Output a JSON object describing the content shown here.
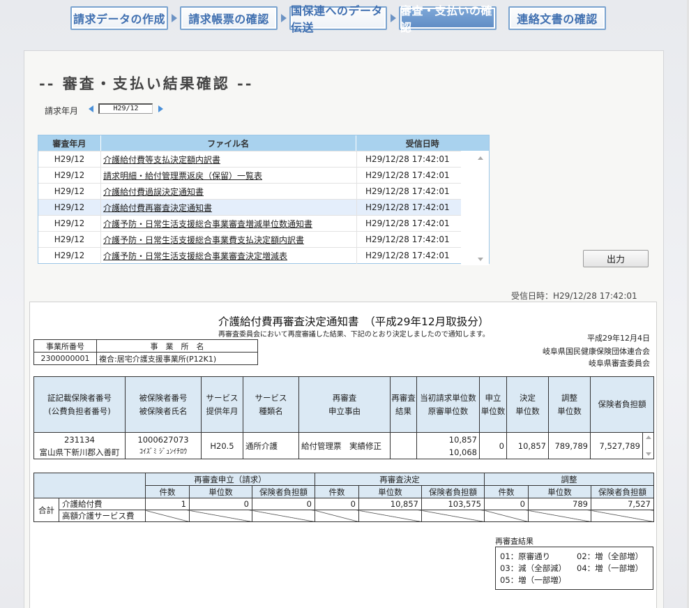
{
  "nav": {
    "items": [
      {
        "label": "請求データの作成",
        "active": false
      },
      {
        "label": "請求帳票の確認",
        "active": false
      },
      {
        "label": "国保連へのデータ伝送",
        "active": false
      },
      {
        "label": "審査・支払いの確認",
        "active": true
      },
      {
        "label": "連絡文書の確認",
        "active": false
      }
    ]
  },
  "page": {
    "title": "-- 審査・支払い結果確認 --",
    "year_month_label": "請求年月",
    "year_month_value": "H29/12"
  },
  "file_table": {
    "headers": [
      "審査年月",
      "ファイル名",
      "受信日時"
    ],
    "rows": [
      {
        "ym": "H29/12",
        "name": "介護給付費等支払決定額内訳書",
        "received": "H29/12/28 17:42:01"
      },
      {
        "ym": "H29/12",
        "name": "請求明細・給付管理票返戻（保留）一覧表",
        "received": "H29/12/28 17:42:01"
      },
      {
        "ym": "H29/12",
        "name": "介護給付費過誤決定通知書",
        "received": "H29/12/28 17:42:01"
      },
      {
        "ym": "H29/12",
        "name": "介護給付費再審査決定通知書",
        "received": "H29/12/28 17:42:01",
        "selected": true
      },
      {
        "ym": "H29/12",
        "name": "介護予防・日常生活支援総合事業審査増減単位数通知書",
        "received": "H29/12/28 17:42:01"
      },
      {
        "ym": "H29/12",
        "name": "介護予防・日常生活支援総合事業費支払決定額内訳書",
        "received": "H29/12/28 17:42:01"
      },
      {
        "ym": "H29/12",
        "name": "介護予防・日常生活支援総合事業審査決定増減表",
        "received": "H29/12/28 17:42:01"
      }
    ]
  },
  "output_button": "出力",
  "received_label": "受信日時：H29/12/28 17:42:01",
  "document": {
    "title": "介護給付費再審査決定通知書　（平成29年12月取扱分）",
    "subtitle": "再審査委員会において再度審議した結果、下記のとおり決定しましたので通知します。",
    "date": "平成29年12月4日",
    "issuer1": "岐阜県国民健康保険団体連合会",
    "issuer2": "岐阜県審査委員会",
    "office": {
      "h_number": "事業所番号",
      "h_name": "事　業　所　名",
      "number": "2300000001",
      "name": "複合:居宅介護支援事業所(P12K1)"
    },
    "main_headers": {
      "h1a": "証記載保険者番号",
      "h1b": "(公費負担者番号)",
      "h2a": "被保険者番号",
      "h2b": "被保険者氏名",
      "h3a": "サービス",
      "h3b": "提供年月",
      "h4a": "サービス",
      "h4b": "種類名",
      "h5a": "再審査",
      "h5b": "申立事由",
      "h6a": "再審査",
      "h6b": "結果",
      "h7a": "当初請求単位数",
      "h7b": "原審単位数",
      "h8a": "申立",
      "h8b": "単位数",
      "h9a": "決定",
      "h9b": "単位数",
      "h10a": "調整",
      "h10b": "単位数",
      "h11": "保険者負担額"
    },
    "main_row": {
      "insurer_no": "231134",
      "insurer_name": "富山県下新川郡入善町",
      "insured_no": "1000627073",
      "insured_name": "ｺｲｽﾞﾐ ｼﾞｭﾝｲﾁﾛｳ",
      "service_ym": "H20.5",
      "service_type": "通所介護",
      "reason": "給付管理票　実績修正",
      "result": "",
      "initial_units": "10,857",
      "original_units": "10,068",
      "claim_units": "0",
      "decided_units": "10,857",
      "adjust_units": "789,789",
      "insurer_burden": "7,527,789"
    },
    "summary": {
      "group1": "再審査申立（請求）",
      "group2": "再審査決定",
      "group3": "調整",
      "sub_count": "件数",
      "sub_units": "単位数",
      "sub_burden": "保険者負担額",
      "total_label": "合計",
      "row1_label": "介護給付費",
      "row2_label": "高額介護サービス費",
      "row1": [
        "1",
        "0",
        "0",
        "0",
        "10,857",
        "103,575",
        "0",
        "789",
        "7,527"
      ]
    },
    "legend_label": "再審査結果",
    "legend": {
      "l1": "01：原審通り",
      "l2": "02：増（全部増）",
      "l3": "03：減（全部減）",
      "l4": "04：増（一部増）",
      "l5": "05：増（一部増）"
    }
  }
}
